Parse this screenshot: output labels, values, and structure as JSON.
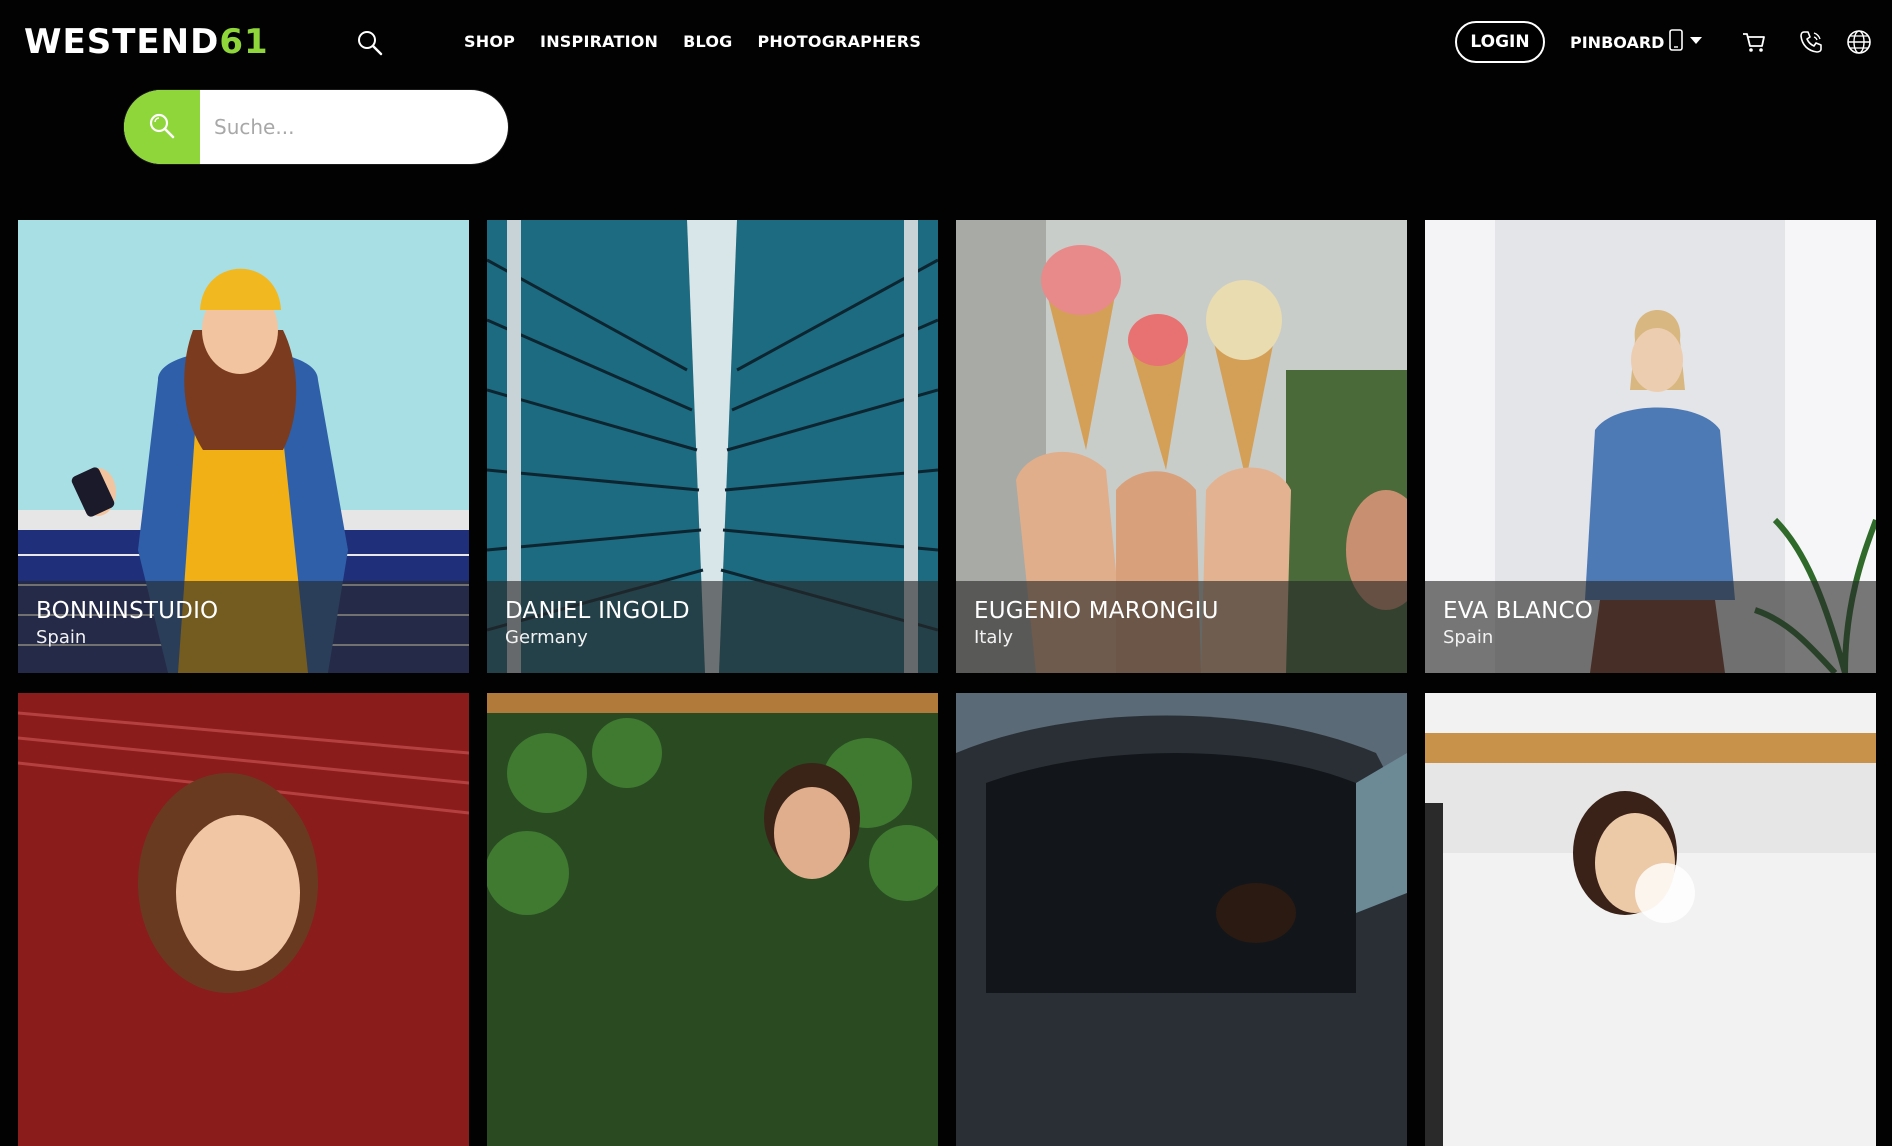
{
  "header": {
    "logo_main": "WESTEND",
    "logo_accent": "61",
    "nav": [
      {
        "label": "SHOP",
        "icon": ""
      },
      {
        "label": "INSPIRATION"
      },
      {
        "label": "BLOG"
      },
      {
        "label": "PHOTOGRAPHERS"
      }
    ],
    "login_label": "LOGIN",
    "pinboard_label": "PINBOARD",
    "icons": [
      "search-icon",
      "phone-device-icon",
      "chevron-down-icon",
      "cart-icon",
      "phone-call-icon",
      "globe-icon"
    ]
  },
  "search": {
    "placeholder": "Suche..."
  },
  "colors": {
    "accent": "#8fd63a",
    "background": "#020202",
    "caption_overlay": "rgba(40,40,40,0.62)"
  },
  "photographers": [
    {
      "name": "BONNINSTUDIO",
      "country": "Spain"
    },
    {
      "name": "DANIEL INGOLD",
      "country": "Germany"
    },
    {
      "name": "EUGENIO MARONGIU",
      "country": "Italy"
    },
    {
      "name": "EVA BLANCO",
      "country": "Spain"
    },
    {
      "name": "",
      "country": ""
    },
    {
      "name": "",
      "country": ""
    },
    {
      "name": "",
      "country": ""
    },
    {
      "name": "",
      "country": ""
    }
  ]
}
